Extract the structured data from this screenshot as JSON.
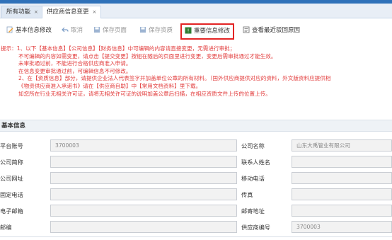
{
  "tabs": [
    {
      "label": "所有功能",
      "close": "×"
    },
    {
      "label": "供应商信息变更",
      "close": "×"
    }
  ],
  "toolbar": {
    "basic_edit": "基本信息修改",
    "cancel": "取消",
    "save_page": "保存页面",
    "save_qual": "保存资质",
    "important_edit": "重要信息修改",
    "view_reason": "查看最近驳回原因"
  },
  "notice": {
    "line1": "提示：1、以下【基本信息】【公司信息】【财务信息】中可编辑的内容请直接变更，无需进行审批；",
    "line2": "不可编辑的内容如需变更，请点击【提交变更】按钮在随后的页面里进行变更，变更后需审批通过才能生效。",
    "line3": "未审批通过前，不能进行合格供应商准入申请。",
    "line4": "在信息变更审批通过前，可编辑信息不可修改。",
    "line5": "2、在【资质信息】部分，请提供企业法人代表签字并加盖单位公章的所有材料。（国外供应商提供对应的资料，外文版资料应提供相",
    "line6": "《物资供应商准入承诺书》请在【供应商自助】中【常用文档资料】里下载。",
    "line7": "如您所在行业无相关许可证，请将无相关许可证的说明加盖公章后扫描，在相应资质文件上传的位置上传。"
  },
  "section_title": "基本信息",
  "form": {
    "rows": [
      {
        "label1": "平台账号",
        "value1": "3700003",
        "label2": "公司名称",
        "value2": "山东大禹管业有限公司"
      },
      {
        "label1": "公司简称",
        "value1": "",
        "label2": "联系人姓名",
        "value2": ""
      },
      {
        "label1": "公司网址",
        "value1": "",
        "label2": "移动电话",
        "value2": ""
      },
      {
        "label1": "固定电话",
        "value1": "",
        "label2": "传真",
        "value2": ""
      },
      {
        "label1": "电子邮箱",
        "value1": "",
        "label2": "邮寄地址",
        "value2": ""
      },
      {
        "label1": "邮编",
        "value1": "",
        "label2": "供应商编号",
        "value2": "3700003"
      }
    ]
  },
  "colors": {
    "accent": "#2f71b9",
    "notice_red": "#e23b3b",
    "highlight_border": "#e32424",
    "input_bg": "#f2f2f2"
  }
}
